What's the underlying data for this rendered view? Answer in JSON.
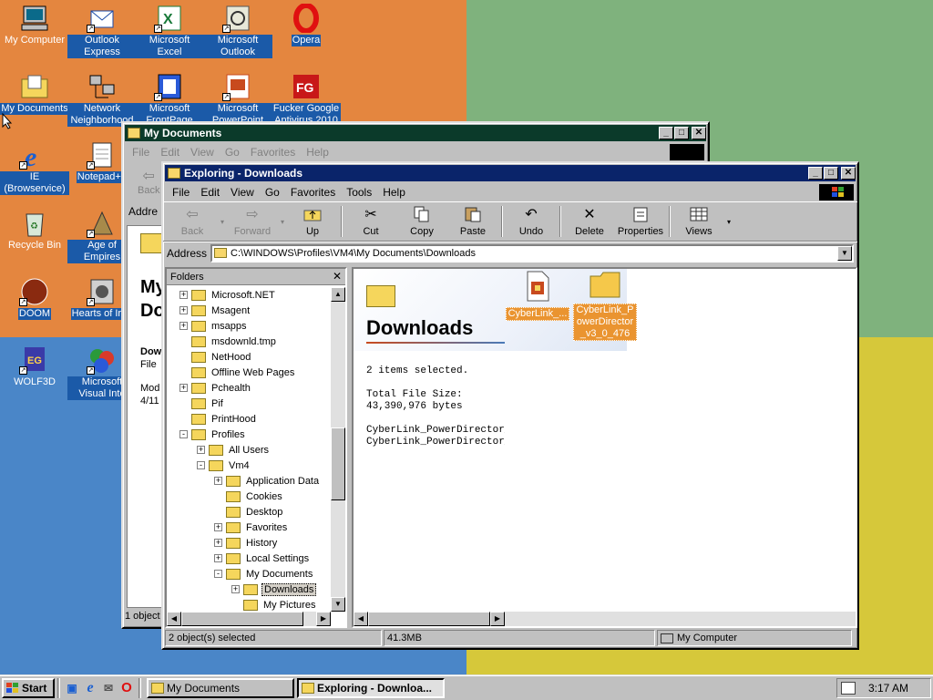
{
  "desktop": {
    "icons": [
      {
        "label": "My Computer"
      },
      {
        "label": "Outlook Express"
      },
      {
        "label": "Microsoft Excel"
      },
      {
        "label": "Microsoft Outlook"
      },
      {
        "label": "Opera"
      },
      {
        "label": "My Documents"
      },
      {
        "label": "Network Neighborhood"
      },
      {
        "label": "Microsoft FrontPage"
      },
      {
        "label": "Microsoft PowerPoint"
      },
      {
        "label": "Fucker Google Antivirus 2010"
      },
      {
        "label": "IE (Browservice)"
      },
      {
        "label": "Notepad++"
      },
      {
        "label": "Recycle Bin"
      },
      {
        "label": "Age of Empires"
      },
      {
        "label": "DOOM"
      },
      {
        "label": "Hearts of Iron"
      },
      {
        "label": "WOLF3D"
      },
      {
        "label": "Microsoft Visual Inte"
      }
    ]
  },
  "back_window": {
    "title": "My Documents",
    "menu": [
      "File",
      "Edit",
      "View",
      "Go",
      "Favorites",
      "Help"
    ],
    "back_label": "Back",
    "address_label": "Addre",
    "big_title_1": "My",
    "big_title_2": "Do",
    "info_1": "Dow",
    "info_2": "File",
    "info_3": "Mod",
    "info_4": "4/11",
    "status": "1 object"
  },
  "explorer": {
    "title": "Exploring - Downloads",
    "menu": [
      "File",
      "Edit",
      "View",
      "Go",
      "Favorites",
      "Tools",
      "Help"
    ],
    "toolbar": {
      "back": "Back",
      "forward": "Forward",
      "up": "Up",
      "cut": "Cut",
      "copy": "Copy",
      "paste": "Paste",
      "undo": "Undo",
      "delete": "Delete",
      "properties": "Properties",
      "views": "Views"
    },
    "address_label": "Address",
    "address_value": "C:\\WINDOWS\\Profiles\\VM4\\My Documents\\Downloads",
    "folders_header": "Folders",
    "tree": [
      {
        "label": "Microsoft.NET",
        "indent": 0,
        "pm": "+"
      },
      {
        "label": "Msagent",
        "indent": 0,
        "pm": "+"
      },
      {
        "label": "msapps",
        "indent": 0,
        "pm": "+"
      },
      {
        "label": "msdownld.tmp",
        "indent": 0,
        "pm": ""
      },
      {
        "label": "NetHood",
        "indent": 0,
        "pm": ""
      },
      {
        "label": "Offline Web Pages",
        "indent": 0,
        "pm": ""
      },
      {
        "label": "Pchealth",
        "indent": 0,
        "pm": "+"
      },
      {
        "label": "Pif",
        "indent": 0,
        "pm": ""
      },
      {
        "label": "PrintHood",
        "indent": 0,
        "pm": ""
      },
      {
        "label": "Profiles",
        "indent": 0,
        "pm": "-"
      },
      {
        "label": "All Users",
        "indent": 1,
        "pm": "+"
      },
      {
        "label": "Vm4",
        "indent": 1,
        "pm": "-"
      },
      {
        "label": "Application Data",
        "indent": 2,
        "pm": "+"
      },
      {
        "label": "Cookies",
        "indent": 2,
        "pm": ""
      },
      {
        "label": "Desktop",
        "indent": 2,
        "pm": ""
      },
      {
        "label": "Favorites",
        "indent": 2,
        "pm": "+"
      },
      {
        "label": "History",
        "indent": 2,
        "pm": "+"
      },
      {
        "label": "Local Settings",
        "indent": 2,
        "pm": "+"
      },
      {
        "label": "My Documents",
        "indent": 2,
        "pm": "-"
      },
      {
        "label": "Downloads",
        "indent": 3,
        "pm": "+",
        "selected": true
      },
      {
        "label": "My Pictures",
        "indent": 3,
        "pm": ""
      }
    ],
    "content": {
      "folder_title": "Downloads",
      "selection_summary": "2 items selected.",
      "size_label": "Total File Size:",
      "size_value": "43,390,976 bytes",
      "file_1": "CyberLink_PowerDirector_",
      "file_2": "CyberLink_PowerDirector_",
      "items": [
        {
          "label": "CyberLink_..."
        },
        {
          "label": "CyberLink_PowerDirector_v3_0_476"
        }
      ]
    },
    "status": {
      "objects": "2 object(s) selected",
      "size": "41.3MB",
      "zone": "My Computer"
    }
  },
  "taskbar": {
    "start": "Start",
    "tasks": [
      {
        "label": "My Documents"
      },
      {
        "label": "Exploring - Downloa..."
      }
    ],
    "clock": "3:17 AM"
  }
}
